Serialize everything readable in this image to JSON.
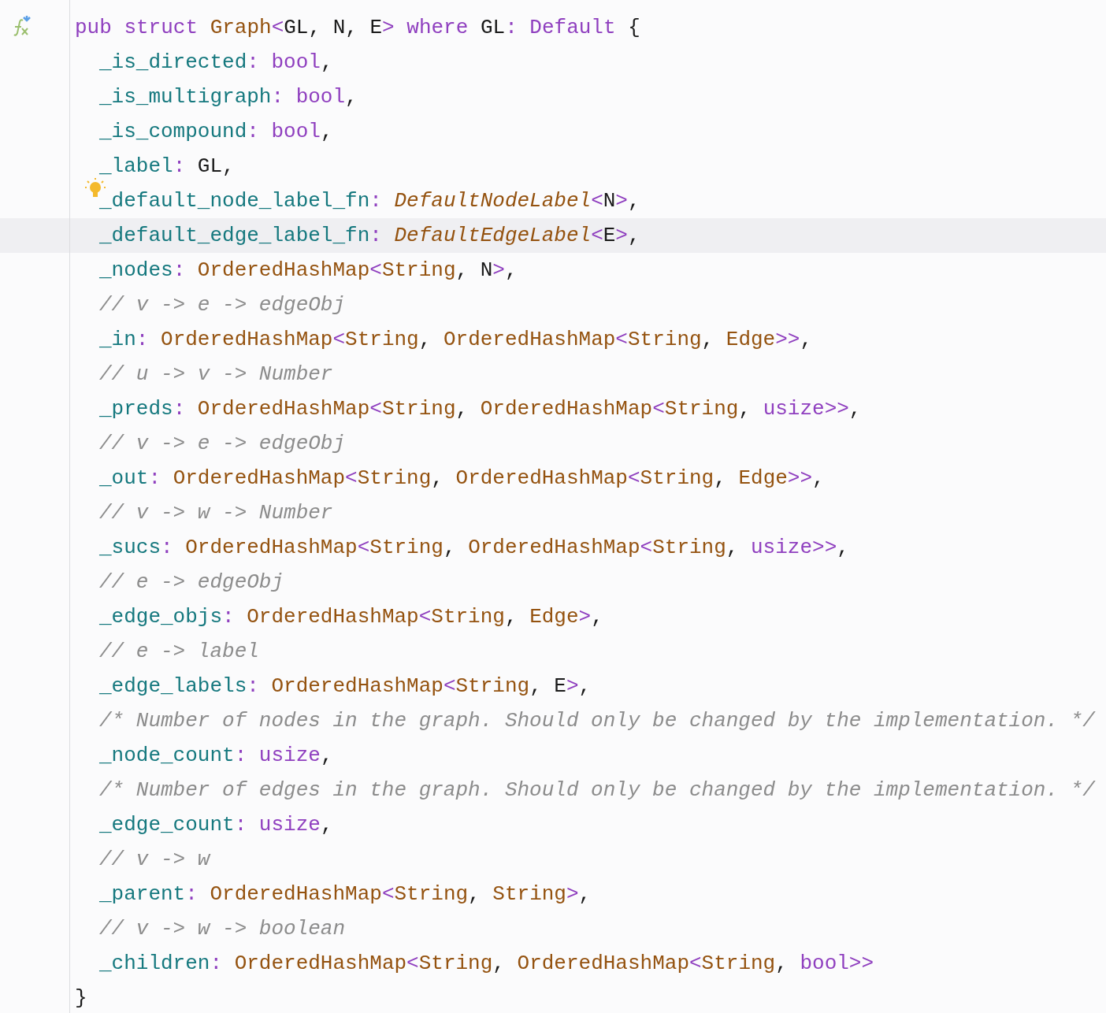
{
  "editor": {
    "lines": [
      {
        "function_marker": true,
        "tokens": [
          {
            "kind": "kw",
            "text": "pub struct "
          },
          {
            "kind": "type",
            "text": "Graph"
          },
          {
            "kind": "op",
            "text": "<"
          },
          {
            "kind": "plain",
            "text": "GL, N, E"
          },
          {
            "kind": "op",
            "text": ">"
          },
          {
            "kind": "kw",
            "text": " where "
          },
          {
            "kind": "plain",
            "text": "GL"
          },
          {
            "kind": "op",
            "text": ": "
          },
          {
            "kind": "kw",
            "text": "Default"
          },
          {
            "kind": "plain",
            "text": " {"
          }
        ],
        "children": [
          {
            "tokens": [
              {
                "kind": "field",
                "text": "_is_directed"
              },
              {
                "kind": "op",
                "text": ": "
              },
              {
                "kind": "kw",
                "text": "bool"
              },
              {
                "kind": "plain",
                "text": ","
              }
            ]
          },
          {
            "tokens": [
              {
                "kind": "field",
                "text": "_is_multigraph"
              },
              {
                "kind": "op",
                "text": ": "
              },
              {
                "kind": "kw",
                "text": "bool"
              },
              {
                "kind": "plain",
                "text": ","
              }
            ]
          },
          {
            "tokens": [
              {
                "kind": "field",
                "text": "_is_compound"
              },
              {
                "kind": "op",
                "text": ": "
              },
              {
                "kind": "kw",
                "text": "bool"
              },
              {
                "kind": "plain",
                "text": ","
              }
            ]
          },
          {
            "tokens": [
              {
                "kind": "field",
                "text": "_label"
              },
              {
                "kind": "op",
                "text": ": "
              },
              {
                "kind": "plain",
                "text": "GL,"
              }
            ]
          },
          {
            "hint_bulb": true,
            "tokens": [
              {
                "kind": "field",
                "text": "_default_node_label_fn"
              },
              {
                "kind": "op",
                "text": ": "
              },
              {
                "kind": "typei",
                "text": "DefaultNodeLabel"
              },
              {
                "kind": "op",
                "text": "<"
              },
              {
                "kind": "plain",
                "text": "N"
              },
              {
                "kind": "op",
                "text": ">"
              },
              {
                "kind": "plain",
                "text": ","
              }
            ]
          },
          {
            "current": true,
            "tokens": [
              {
                "kind": "field",
                "text": "_default_edge_label_fn"
              },
              {
                "kind": "op",
                "text": ": "
              },
              {
                "kind": "typei",
                "text": "DefaultEdgeLabel"
              },
              {
                "kind": "op",
                "text": "<"
              },
              {
                "kind": "plain",
                "text": "E"
              },
              {
                "kind": "op",
                "text": ">"
              },
              {
                "kind": "plain",
                "text": ","
              }
            ]
          },
          {
            "tokens": [
              {
                "kind": "field",
                "text": "_nodes"
              },
              {
                "kind": "op",
                "text": ": "
              },
              {
                "kind": "type",
                "text": "OrderedHashMap"
              },
              {
                "kind": "op",
                "text": "<"
              },
              {
                "kind": "type",
                "text": "String"
              },
              {
                "kind": "plain",
                "text": ", N"
              },
              {
                "kind": "op",
                "text": ">"
              },
              {
                "kind": "plain",
                "text": ","
              }
            ]
          },
          {
            "tokens": [
              {
                "kind": "comment",
                "text": "// v -> e -> edgeObj"
              }
            ]
          },
          {
            "tokens": [
              {
                "kind": "field",
                "text": "_in"
              },
              {
                "kind": "op",
                "text": ": "
              },
              {
                "kind": "type",
                "text": "OrderedHashMap"
              },
              {
                "kind": "op",
                "text": "<"
              },
              {
                "kind": "type",
                "text": "String"
              },
              {
                "kind": "plain",
                "text": ", "
              },
              {
                "kind": "type",
                "text": "OrderedHashMap"
              },
              {
                "kind": "op",
                "text": "<"
              },
              {
                "kind": "type",
                "text": "String"
              },
              {
                "kind": "plain",
                "text": ", "
              },
              {
                "kind": "type",
                "text": "Edge"
              },
              {
                "kind": "op",
                "text": ">>"
              },
              {
                "kind": "plain",
                "text": ","
              }
            ]
          },
          {
            "tokens": [
              {
                "kind": "comment",
                "text": "// u -> v -> Number"
              }
            ]
          },
          {
            "tokens": [
              {
                "kind": "field",
                "text": "_preds"
              },
              {
                "kind": "op",
                "text": ": "
              },
              {
                "kind": "type",
                "text": "OrderedHashMap"
              },
              {
                "kind": "op",
                "text": "<"
              },
              {
                "kind": "type",
                "text": "String"
              },
              {
                "kind": "plain",
                "text": ", "
              },
              {
                "kind": "type",
                "text": "OrderedHashMap"
              },
              {
                "kind": "op",
                "text": "<"
              },
              {
                "kind": "type",
                "text": "String"
              },
              {
                "kind": "plain",
                "text": ", "
              },
              {
                "kind": "kw",
                "text": "usize"
              },
              {
                "kind": "op",
                "text": ">>"
              },
              {
                "kind": "plain",
                "text": ","
              }
            ]
          },
          {
            "tokens": [
              {
                "kind": "comment",
                "text": "// v -> e -> edgeObj"
              }
            ]
          },
          {
            "tokens": [
              {
                "kind": "field",
                "text": "_out"
              },
              {
                "kind": "op",
                "text": ": "
              },
              {
                "kind": "type",
                "text": "OrderedHashMap"
              },
              {
                "kind": "op",
                "text": "<"
              },
              {
                "kind": "type",
                "text": "String"
              },
              {
                "kind": "plain",
                "text": ", "
              },
              {
                "kind": "type",
                "text": "OrderedHashMap"
              },
              {
                "kind": "op",
                "text": "<"
              },
              {
                "kind": "type",
                "text": "String"
              },
              {
                "kind": "plain",
                "text": ", "
              },
              {
                "kind": "type",
                "text": "Edge"
              },
              {
                "kind": "op",
                "text": ">>"
              },
              {
                "kind": "plain",
                "text": ","
              }
            ]
          },
          {
            "tokens": [
              {
                "kind": "comment",
                "text": "// v -> w -> Number"
              }
            ]
          },
          {
            "tokens": [
              {
                "kind": "field",
                "text": "_sucs"
              },
              {
                "kind": "op",
                "text": ": "
              },
              {
                "kind": "type",
                "text": "OrderedHashMap"
              },
              {
                "kind": "op",
                "text": "<"
              },
              {
                "kind": "type",
                "text": "String"
              },
              {
                "kind": "plain",
                "text": ", "
              },
              {
                "kind": "type",
                "text": "OrderedHashMap"
              },
              {
                "kind": "op",
                "text": "<"
              },
              {
                "kind": "type",
                "text": "String"
              },
              {
                "kind": "plain",
                "text": ", "
              },
              {
                "kind": "kw",
                "text": "usize"
              },
              {
                "kind": "op",
                "text": ">>"
              },
              {
                "kind": "plain",
                "text": ","
              }
            ]
          },
          {
            "tokens": [
              {
                "kind": "comment",
                "text": "// e -> edgeObj"
              }
            ]
          },
          {
            "tokens": [
              {
                "kind": "field",
                "text": "_edge_objs"
              },
              {
                "kind": "op",
                "text": ": "
              },
              {
                "kind": "type",
                "text": "OrderedHashMap"
              },
              {
                "kind": "op",
                "text": "<"
              },
              {
                "kind": "type",
                "text": "String"
              },
              {
                "kind": "plain",
                "text": ", "
              },
              {
                "kind": "type",
                "text": "Edge"
              },
              {
                "kind": "op",
                "text": ">"
              },
              {
                "kind": "plain",
                "text": ","
              }
            ]
          },
          {
            "tokens": [
              {
                "kind": "comment",
                "text": "// e -> label"
              }
            ]
          },
          {
            "tokens": [
              {
                "kind": "field",
                "text": "_edge_labels"
              },
              {
                "kind": "op",
                "text": ": "
              },
              {
                "kind": "type",
                "text": "OrderedHashMap"
              },
              {
                "kind": "op",
                "text": "<"
              },
              {
                "kind": "type",
                "text": "String"
              },
              {
                "kind": "plain",
                "text": ", E"
              },
              {
                "kind": "op",
                "text": ">"
              },
              {
                "kind": "plain",
                "text": ","
              }
            ]
          },
          {
            "tokens": [
              {
                "kind": "comment",
                "text": "/* Number of nodes in the graph. Should only be changed by the implementation. */"
              }
            ]
          },
          {
            "tokens": [
              {
                "kind": "field",
                "text": "_node_count"
              },
              {
                "kind": "op",
                "text": ": "
              },
              {
                "kind": "kw",
                "text": "usize"
              },
              {
                "kind": "plain",
                "text": ","
              }
            ]
          },
          {
            "tokens": [
              {
                "kind": "comment",
                "text": "/* Number of edges in the graph. Should only be changed by the implementation. */"
              }
            ]
          },
          {
            "tokens": [
              {
                "kind": "field",
                "text": "_edge_count"
              },
              {
                "kind": "op",
                "text": ": "
              },
              {
                "kind": "kw",
                "text": "usize"
              },
              {
                "kind": "plain",
                "text": ","
              }
            ]
          },
          {
            "tokens": [
              {
                "kind": "comment",
                "text": "// v -> w"
              }
            ]
          },
          {
            "tokens": [
              {
                "kind": "field",
                "text": "_parent"
              },
              {
                "kind": "op",
                "text": ": "
              },
              {
                "kind": "type",
                "text": "OrderedHashMap"
              },
              {
                "kind": "op",
                "text": "<"
              },
              {
                "kind": "type",
                "text": "String"
              },
              {
                "kind": "plain",
                "text": ", "
              },
              {
                "kind": "type",
                "text": "String"
              },
              {
                "kind": "op",
                "text": ">"
              },
              {
                "kind": "plain",
                "text": ","
              }
            ]
          },
          {
            "tokens": [
              {
                "kind": "comment",
                "text": "// v -> w -> boolean"
              }
            ]
          },
          {
            "tokens": [
              {
                "kind": "field",
                "text": "_children"
              },
              {
                "kind": "op",
                "text": ": "
              },
              {
                "kind": "type",
                "text": "OrderedHashMap"
              },
              {
                "kind": "op",
                "text": "<"
              },
              {
                "kind": "type",
                "text": "String"
              },
              {
                "kind": "plain",
                "text": ", "
              },
              {
                "kind": "type",
                "text": "OrderedHashMap"
              },
              {
                "kind": "op",
                "text": "<"
              },
              {
                "kind": "type",
                "text": "String"
              },
              {
                "kind": "plain",
                "text": ", "
              },
              {
                "kind": "kw",
                "text": "bool"
              },
              {
                "kind": "op",
                "text": ">>"
              }
            ]
          }
        ]
      },
      {
        "tokens": [
          {
            "kind": "plain",
            "text": "}"
          }
        ]
      }
    ]
  }
}
